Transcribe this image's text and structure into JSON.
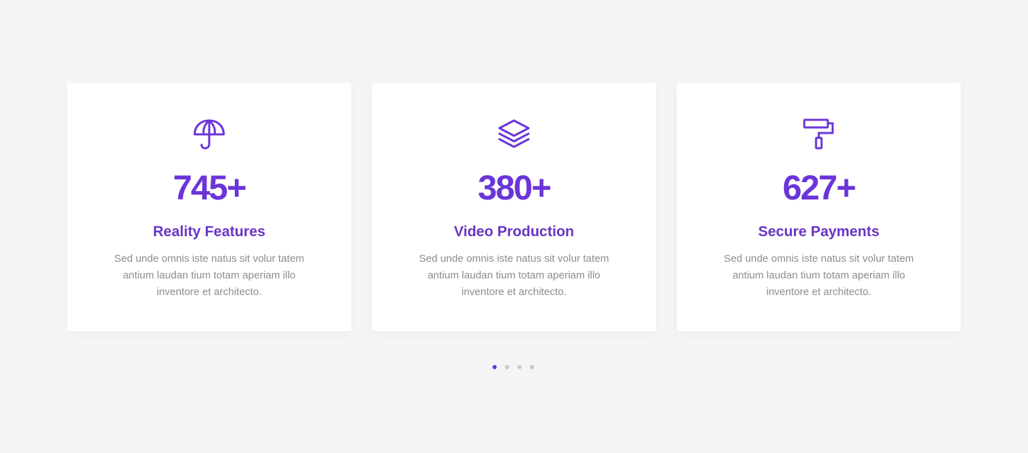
{
  "colors": {
    "accent": "#6a35d8",
    "title": "#6a35c4",
    "text": "#8c8c8c",
    "background": "#f5f5f5",
    "card": "#ffffff",
    "dot_inactive": "#c8c8c8"
  },
  "cards": [
    {
      "icon": "umbrella-icon",
      "number": "745+",
      "title": "Reality Features",
      "description": "Sed unde omnis iste natus sit volur tatem antium laudan tium totam aperiam illo inventore et architecto."
    },
    {
      "icon": "layers-icon",
      "number": "380+",
      "title": "Video Production",
      "description": "Sed unde omnis iste natus sit volur tatem antium laudan tium totam aperiam illo inventore et architecto."
    },
    {
      "icon": "paint-roller-icon",
      "number": "627+",
      "title": "Secure Payments",
      "description": "Sed unde omnis iste natus sit volur tatem antium laudan tium totam aperiam illo inventore et architecto."
    }
  ],
  "pagination": {
    "total": 4,
    "active_index": 0
  }
}
